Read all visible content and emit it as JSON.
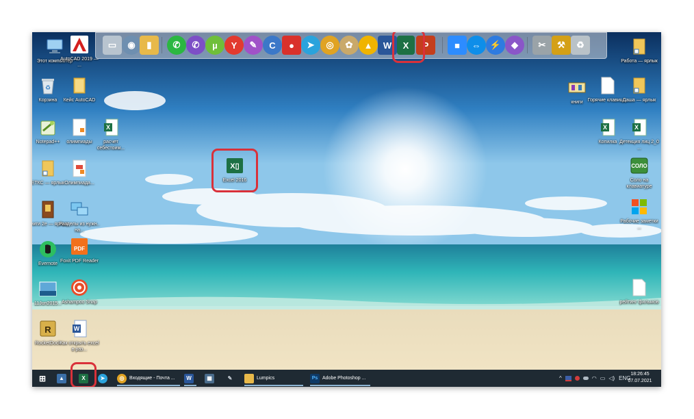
{
  "desktop_icons_left": [
    {
      "label": "Этот компьютер",
      "icon": "computer-icon"
    },
    {
      "label": "AutoCAD 2019 — ...",
      "icon": "autocad-icon"
    },
    {
      "label": "Корзина",
      "icon": "recycle-bin-icon"
    },
    {
      "label": "Кейс AutoCAD",
      "icon": "folder-icon"
    },
    {
      "label": "Notepad++",
      "icon": "notepad-plus-icon"
    },
    {
      "label": "олимпиады",
      "icon": "document-icon"
    },
    {
      "label": "расчет себестоим...",
      "icon": "excel-file-icon"
    },
    {
      "label": "ЕТКС — ярлык",
      "icon": "folder-shortcut-icon"
    },
    {
      "label": "Олимпиада...",
      "icon": "document-icon"
    },
    {
      "label": "Книги 2е — ярлык",
      "icon": "book-shortcut-icon"
    },
    {
      "label": "Разделы из нужн.. на...",
      "icon": "network-icon"
    },
    {
      "label": "Evernote",
      "icon": "evernote-icon"
    },
    {
      "label": "Foxit PDF Reader",
      "icon": "foxit-pdf-icon"
    },
    {
      "label": "11Jun2015...",
      "icon": "image-file-icon"
    },
    {
      "label": "Ashampoo Snap",
      "icon": "ashampoo-snap-icon"
    },
    {
      "label": "RocketDock",
      "icon": "rocketdock-icon"
    },
    {
      "label": "Как открыть excel в раз...",
      "icon": "word-file-icon"
    }
  ],
  "desktop_icons_right": [
    {
      "label": "Работа — ярлык",
      "icon": "folder-shortcut-icon"
    },
    {
      "label": "книги",
      "icon": "books-icon"
    },
    {
      "label": "Горячие клавиш...",
      "icon": "text-file-icon"
    },
    {
      "label": "Даша — ярлык",
      "icon": "folder-shortcut-icon"
    },
    {
      "label": "Копилка",
      "icon": "excel-file-icon"
    },
    {
      "label": "Детекция лиц 2_0 ...",
      "icon": "excel-file-icon"
    },
    {
      "label": "Соло на клавиатуре",
      "icon": "solo-icon"
    },
    {
      "label": "Рабочие заметки ...",
      "icon": "windows-flag-icon"
    },
    {
      "label": "рейтинг фильмов",
      "icon": "text-file-icon"
    }
  ],
  "center_icon": {
    "label": "Excel 2016",
    "icon": "excel-icon"
  },
  "dock_items": [
    {
      "name": "computer",
      "glyph": "▭",
      "color": "#b8c4cf"
    },
    {
      "name": "network",
      "glyph": "◉",
      "color": "#6e8fb0"
    },
    {
      "name": "folder",
      "glyph": "▮",
      "color": "#e8b94a"
    },
    {
      "name": "whatsapp",
      "glyph": "✆",
      "color": "#2bb741"
    },
    {
      "name": "viber",
      "glyph": "✆",
      "color": "#7d4fc6"
    },
    {
      "name": "utorrent",
      "glyph": "µ",
      "color": "#6fbf3a"
    },
    {
      "name": "yandex-browser",
      "glyph": "Y",
      "color": "#e23a2f"
    },
    {
      "name": "feather",
      "glyph": "✎",
      "color": "#a052c8"
    },
    {
      "name": "ccleaner",
      "glyph": "C",
      "color": "#3c78c8"
    },
    {
      "name": "recorder",
      "glyph": "●",
      "color": "#d9312b"
    },
    {
      "name": "telegram",
      "glyph": "➤",
      "color": "#2aa3dc"
    },
    {
      "name": "chrome",
      "glyph": "◎",
      "color": "#e0a323"
    },
    {
      "name": "paint",
      "glyph": "✿",
      "color": "#c9a96a"
    },
    {
      "name": "archicad",
      "glyph": "▲",
      "color": "#f0b400"
    },
    {
      "name": "word",
      "glyph": "W",
      "color": "#2a5699"
    },
    {
      "name": "excel",
      "glyph": "X",
      "color": "#1d7044"
    },
    {
      "name": "powerpoint",
      "glyph": "P",
      "color": "#c43e1c"
    },
    {
      "name": "zoom",
      "glyph": "■",
      "color": "#2d8cff"
    },
    {
      "name": "teamviewer",
      "glyph": "⇔",
      "color": "#0e8ee9"
    },
    {
      "name": "speed",
      "glyph": "⚡",
      "color": "#2e7be0"
    },
    {
      "name": "visual-studio",
      "glyph": "◆",
      "color": "#8a56c8"
    },
    {
      "name": "tools",
      "glyph": "✂",
      "color": "#9aa3a8"
    },
    {
      "name": "settings",
      "glyph": "⚒",
      "color": "#d4a017"
    },
    {
      "name": "recycle-bin",
      "glyph": "♻",
      "color": "#b9c2c8"
    }
  ],
  "taskbar": {
    "pinned": [
      {
        "name": "start",
        "glyph": "⊞",
        "color": "transparent"
      },
      {
        "name": "dock-app",
        "glyph": "▲",
        "color": "#3b6fa8"
      },
      {
        "name": "excel",
        "glyph": "X",
        "color": "#1d7044"
      },
      {
        "name": "telegram",
        "glyph": "➤",
        "color": "#2aa3dc"
      }
    ],
    "windows": [
      {
        "name": "chrome",
        "glyph": "◎",
        "color": "#e0a323",
        "label": "Входящие - Почта ..."
      },
      {
        "name": "word",
        "glyph": "W",
        "color": "#2a5699",
        "label": ""
      },
      {
        "name": "calculator",
        "glyph": "▦",
        "color": "#4a6c8c",
        "label": ""
      },
      {
        "name": "pen",
        "glyph": "✎",
        "color": "transparent",
        "label": ""
      },
      {
        "name": "explorer",
        "glyph": "▮",
        "color": "#e8b94a",
        "label": "Lumpics"
      },
      {
        "name": "photoshop",
        "glyph": "Ps",
        "color": "#0f3a66",
        "label": "Adobe Photoshop ..."
      }
    ],
    "tray": {
      "language": "ENG",
      "time": "18:26:45",
      "date": "07.07.2021"
    }
  },
  "colors": {
    "highlight": "#d9313a",
    "taskbar": "#1f2a33",
    "excel_green": "#1d7044"
  }
}
